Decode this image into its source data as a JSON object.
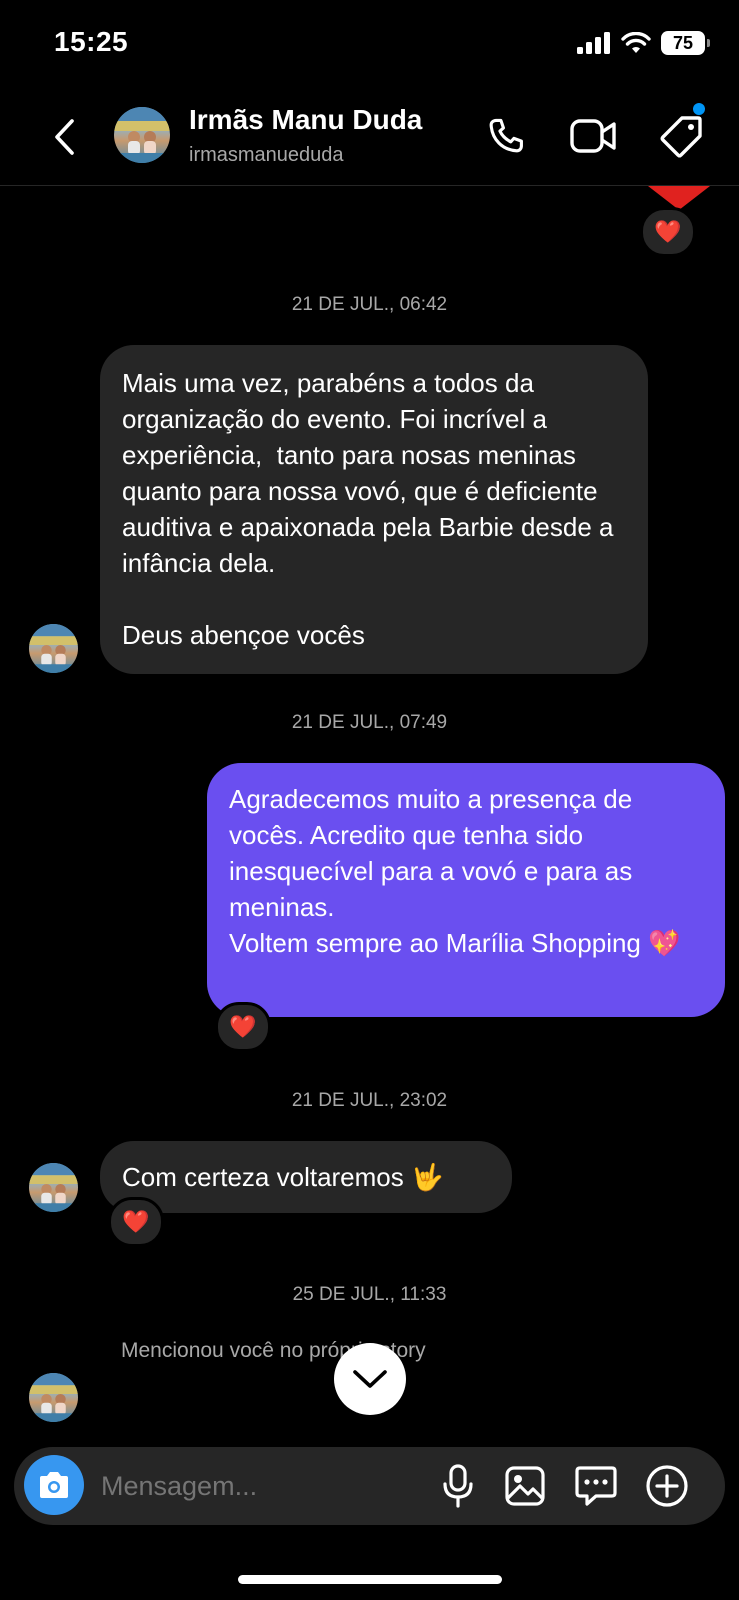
{
  "status_bar": {
    "time": "15:25",
    "battery": "75"
  },
  "header": {
    "name": "Irmãs Manu Duda",
    "handle": "irmasmanueduda",
    "icons": [
      "back-icon",
      "phone-icon",
      "video-icon",
      "tag-icon"
    ]
  },
  "top_reaction": "❤️",
  "thread": [
    {
      "timestamp": "21 DE JUL., 06:42",
      "text": "Mais uma vez, parabéns a todos da organização do evento. Foi incrível a experiência,  tanto para nosas meninas quanto para nossa vovó, que é deficiente auditiva e apaixonada pela Barbie desde a infância dela.\n\nDeus abençoe vocês"
    },
    {
      "timestamp": "21 DE JUL., 07:49",
      "text": "Agradecemos muito a presença de vocês. Acredito que tenha sido inesquecível para a vovó e para as meninas.\nVoltem sempre ao Marília Shopping 💖",
      "reaction": "❤️"
    },
    {
      "timestamp": "21 DE JUL., 23:02",
      "text": "Com certeza voltaremos 🤟",
      "reaction": "❤️"
    },
    {
      "timestamp": "25 DE JUL., 11:33",
      "text": "Mencionou você no próprio story"
    }
  ],
  "composer": {
    "placeholder": "Mensagem..."
  },
  "colors": {
    "outgoing": "#6a4ff0",
    "incoming": "#262626",
    "camera": "#3797f0",
    "accent_dot": "#0095f6"
  }
}
